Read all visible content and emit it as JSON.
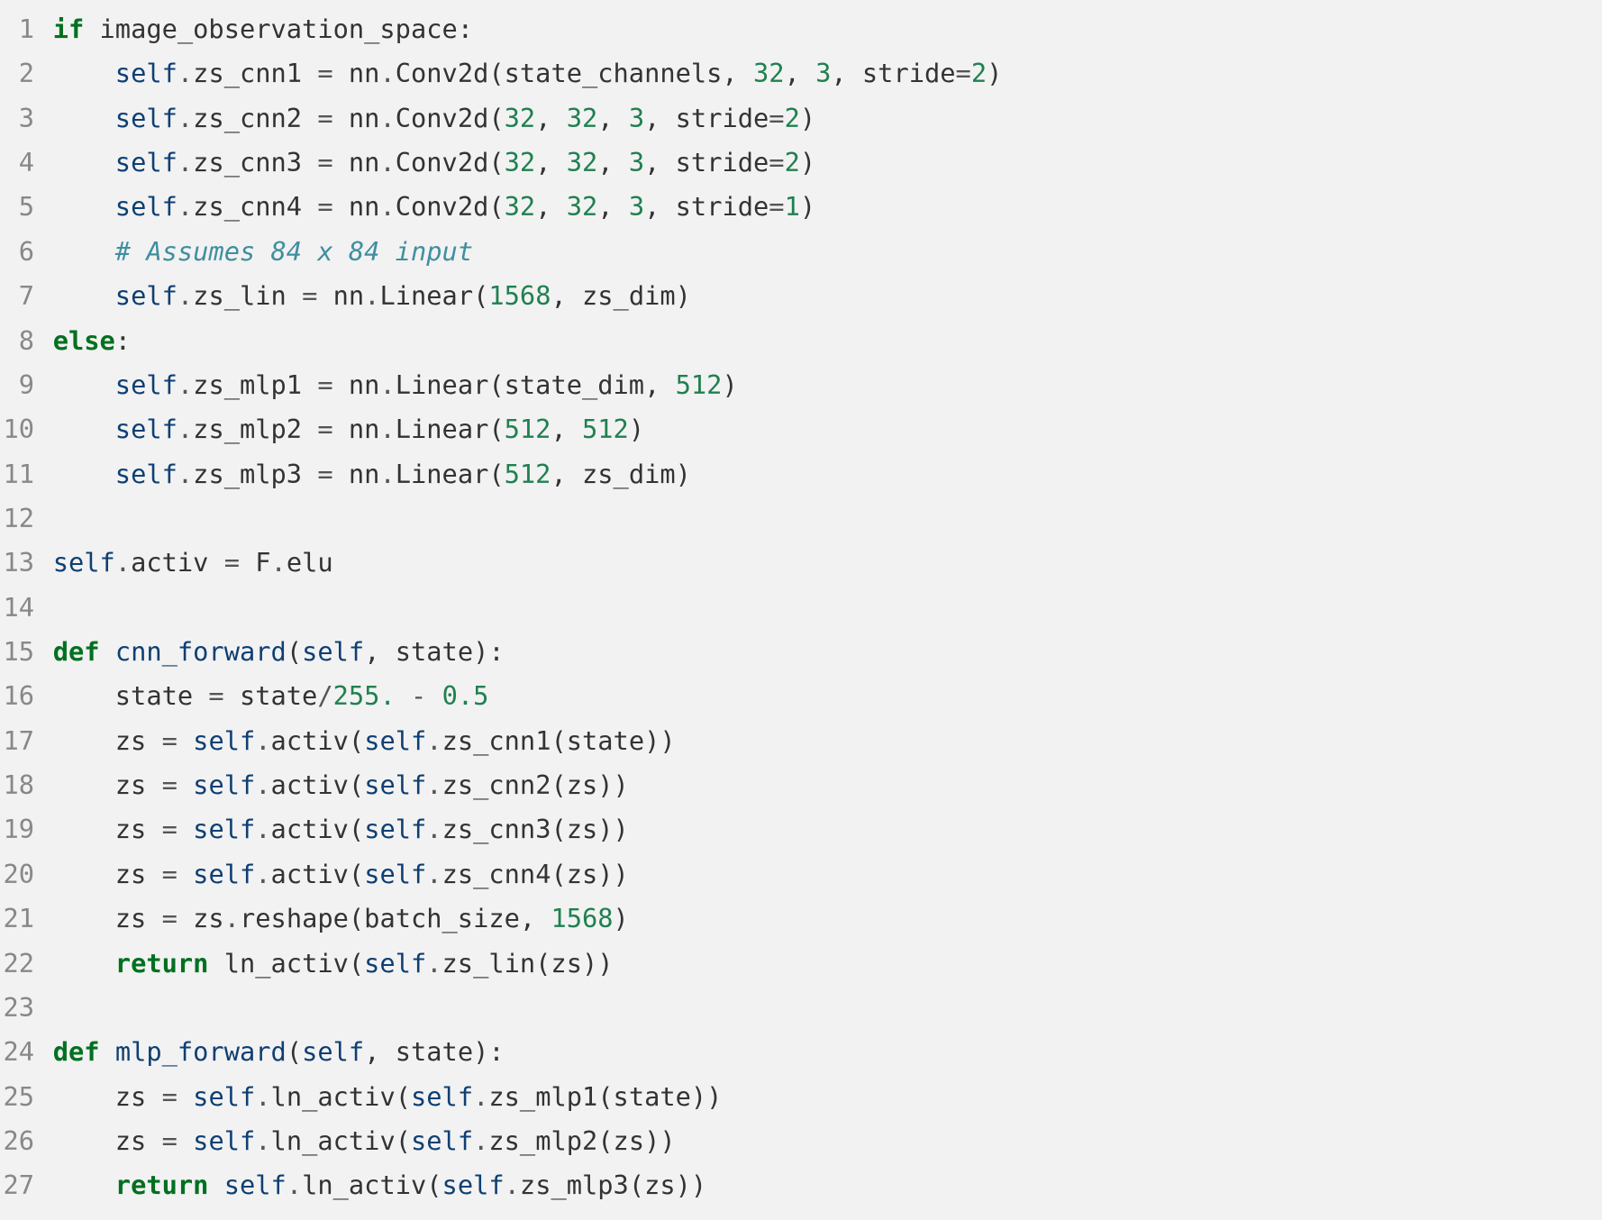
{
  "lines": [
    {
      "n": "1",
      "tokens": [
        {
          "cls": "kw",
          "t": "if"
        },
        {
          "cls": "plain",
          "t": " image_observation_space:"
        }
      ]
    },
    {
      "n": "2",
      "tokens": [
        {
          "cls": "plain",
          "t": "    "
        },
        {
          "cls": "slf",
          "t": "self"
        },
        {
          "cls": "op",
          "t": "."
        },
        {
          "cls": "plain",
          "t": "zs_cnn1 "
        },
        {
          "cls": "op",
          "t": "="
        },
        {
          "cls": "plain",
          "t": " nn"
        },
        {
          "cls": "op",
          "t": "."
        },
        {
          "cls": "plain",
          "t": "Conv2d(state_channels, "
        },
        {
          "cls": "num",
          "t": "32"
        },
        {
          "cls": "plain",
          "t": ", "
        },
        {
          "cls": "num",
          "t": "3"
        },
        {
          "cls": "plain",
          "t": ", stride"
        },
        {
          "cls": "op",
          "t": "="
        },
        {
          "cls": "num",
          "t": "2"
        },
        {
          "cls": "plain",
          "t": ")"
        }
      ]
    },
    {
      "n": "3",
      "tokens": [
        {
          "cls": "plain",
          "t": "    "
        },
        {
          "cls": "slf",
          "t": "self"
        },
        {
          "cls": "op",
          "t": "."
        },
        {
          "cls": "plain",
          "t": "zs_cnn2 "
        },
        {
          "cls": "op",
          "t": "="
        },
        {
          "cls": "plain",
          "t": " nn"
        },
        {
          "cls": "op",
          "t": "."
        },
        {
          "cls": "plain",
          "t": "Conv2d("
        },
        {
          "cls": "num",
          "t": "32"
        },
        {
          "cls": "plain",
          "t": ", "
        },
        {
          "cls": "num",
          "t": "32"
        },
        {
          "cls": "plain",
          "t": ", "
        },
        {
          "cls": "num",
          "t": "3"
        },
        {
          "cls": "plain",
          "t": ", stride"
        },
        {
          "cls": "op",
          "t": "="
        },
        {
          "cls": "num",
          "t": "2"
        },
        {
          "cls": "plain",
          "t": ")"
        }
      ]
    },
    {
      "n": "4",
      "tokens": [
        {
          "cls": "plain",
          "t": "    "
        },
        {
          "cls": "slf",
          "t": "self"
        },
        {
          "cls": "op",
          "t": "."
        },
        {
          "cls": "plain",
          "t": "zs_cnn3 "
        },
        {
          "cls": "op",
          "t": "="
        },
        {
          "cls": "plain",
          "t": " nn"
        },
        {
          "cls": "op",
          "t": "."
        },
        {
          "cls": "plain",
          "t": "Conv2d("
        },
        {
          "cls": "num",
          "t": "32"
        },
        {
          "cls": "plain",
          "t": ", "
        },
        {
          "cls": "num",
          "t": "32"
        },
        {
          "cls": "plain",
          "t": ", "
        },
        {
          "cls": "num",
          "t": "3"
        },
        {
          "cls": "plain",
          "t": ", stride"
        },
        {
          "cls": "op",
          "t": "="
        },
        {
          "cls": "num",
          "t": "2"
        },
        {
          "cls": "plain",
          "t": ")"
        }
      ]
    },
    {
      "n": "5",
      "tokens": [
        {
          "cls": "plain",
          "t": "    "
        },
        {
          "cls": "slf",
          "t": "self"
        },
        {
          "cls": "op",
          "t": "."
        },
        {
          "cls": "plain",
          "t": "zs_cnn4 "
        },
        {
          "cls": "op",
          "t": "="
        },
        {
          "cls": "plain",
          "t": " nn"
        },
        {
          "cls": "op",
          "t": "."
        },
        {
          "cls": "plain",
          "t": "Conv2d("
        },
        {
          "cls": "num",
          "t": "32"
        },
        {
          "cls": "plain",
          "t": ", "
        },
        {
          "cls": "num",
          "t": "32"
        },
        {
          "cls": "plain",
          "t": ", "
        },
        {
          "cls": "num",
          "t": "3"
        },
        {
          "cls": "plain",
          "t": ", stride"
        },
        {
          "cls": "op",
          "t": "="
        },
        {
          "cls": "num",
          "t": "1"
        },
        {
          "cls": "plain",
          "t": ")"
        }
      ]
    },
    {
      "n": "6",
      "tokens": [
        {
          "cls": "plain",
          "t": "    "
        },
        {
          "cls": "cmt",
          "t": "# Assumes 84 x 84 input"
        }
      ]
    },
    {
      "n": "7",
      "tokens": [
        {
          "cls": "plain",
          "t": "    "
        },
        {
          "cls": "slf",
          "t": "self"
        },
        {
          "cls": "op",
          "t": "."
        },
        {
          "cls": "plain",
          "t": "zs_lin "
        },
        {
          "cls": "op",
          "t": "="
        },
        {
          "cls": "plain",
          "t": " nn"
        },
        {
          "cls": "op",
          "t": "."
        },
        {
          "cls": "plain",
          "t": "Linear("
        },
        {
          "cls": "num",
          "t": "1568"
        },
        {
          "cls": "plain",
          "t": ", zs_dim)"
        }
      ]
    },
    {
      "n": "8",
      "tokens": [
        {
          "cls": "kw",
          "t": "else"
        },
        {
          "cls": "plain",
          "t": ":"
        }
      ]
    },
    {
      "n": "9",
      "tokens": [
        {
          "cls": "plain",
          "t": "    "
        },
        {
          "cls": "slf",
          "t": "self"
        },
        {
          "cls": "op",
          "t": "."
        },
        {
          "cls": "plain",
          "t": "zs_mlp1 "
        },
        {
          "cls": "op",
          "t": "="
        },
        {
          "cls": "plain",
          "t": " nn"
        },
        {
          "cls": "op",
          "t": "."
        },
        {
          "cls": "plain",
          "t": "Linear(state_dim, "
        },
        {
          "cls": "num",
          "t": "512"
        },
        {
          "cls": "plain",
          "t": ")"
        }
      ]
    },
    {
      "n": "10",
      "tokens": [
        {
          "cls": "plain",
          "t": "    "
        },
        {
          "cls": "slf",
          "t": "self"
        },
        {
          "cls": "op",
          "t": "."
        },
        {
          "cls": "plain",
          "t": "zs_mlp2 "
        },
        {
          "cls": "op",
          "t": "="
        },
        {
          "cls": "plain",
          "t": " nn"
        },
        {
          "cls": "op",
          "t": "."
        },
        {
          "cls": "plain",
          "t": "Linear("
        },
        {
          "cls": "num",
          "t": "512"
        },
        {
          "cls": "plain",
          "t": ", "
        },
        {
          "cls": "num",
          "t": "512"
        },
        {
          "cls": "plain",
          "t": ")"
        }
      ]
    },
    {
      "n": "11",
      "tokens": [
        {
          "cls": "plain",
          "t": "    "
        },
        {
          "cls": "slf",
          "t": "self"
        },
        {
          "cls": "op",
          "t": "."
        },
        {
          "cls": "plain",
          "t": "zs_mlp3 "
        },
        {
          "cls": "op",
          "t": "="
        },
        {
          "cls": "plain",
          "t": " nn"
        },
        {
          "cls": "op",
          "t": "."
        },
        {
          "cls": "plain",
          "t": "Linear("
        },
        {
          "cls": "num",
          "t": "512"
        },
        {
          "cls": "plain",
          "t": ", zs_dim)"
        }
      ]
    },
    {
      "n": "12",
      "tokens": []
    },
    {
      "n": "13",
      "tokens": [
        {
          "cls": "slf",
          "t": "self"
        },
        {
          "cls": "op",
          "t": "."
        },
        {
          "cls": "plain",
          "t": "activ "
        },
        {
          "cls": "op",
          "t": "="
        },
        {
          "cls": "plain",
          "t": " F"
        },
        {
          "cls": "op",
          "t": "."
        },
        {
          "cls": "plain",
          "t": "elu"
        }
      ]
    },
    {
      "n": "14",
      "tokens": []
    },
    {
      "n": "15",
      "tokens": [
        {
          "cls": "kw",
          "t": "def"
        },
        {
          "cls": "plain",
          "t": " "
        },
        {
          "cls": "nf",
          "t": "cnn_forward"
        },
        {
          "cls": "plain",
          "t": "("
        },
        {
          "cls": "slf",
          "t": "self"
        },
        {
          "cls": "plain",
          "t": ", state):"
        }
      ]
    },
    {
      "n": "16",
      "tokens": [
        {
          "cls": "plain",
          "t": "    state "
        },
        {
          "cls": "op",
          "t": "="
        },
        {
          "cls": "plain",
          "t": " state"
        },
        {
          "cls": "op",
          "t": "/"
        },
        {
          "cls": "num",
          "t": "255."
        },
        {
          "cls": "plain",
          "t": " "
        },
        {
          "cls": "op",
          "t": "-"
        },
        {
          "cls": "plain",
          "t": " "
        },
        {
          "cls": "num",
          "t": "0.5"
        }
      ]
    },
    {
      "n": "17",
      "tokens": [
        {
          "cls": "plain",
          "t": "    zs "
        },
        {
          "cls": "op",
          "t": "="
        },
        {
          "cls": "plain",
          "t": " "
        },
        {
          "cls": "slf",
          "t": "self"
        },
        {
          "cls": "op",
          "t": "."
        },
        {
          "cls": "plain",
          "t": "activ("
        },
        {
          "cls": "slf",
          "t": "self"
        },
        {
          "cls": "op",
          "t": "."
        },
        {
          "cls": "plain",
          "t": "zs_cnn1(state))"
        }
      ]
    },
    {
      "n": "18",
      "tokens": [
        {
          "cls": "plain",
          "t": "    zs "
        },
        {
          "cls": "op",
          "t": "="
        },
        {
          "cls": "plain",
          "t": " "
        },
        {
          "cls": "slf",
          "t": "self"
        },
        {
          "cls": "op",
          "t": "."
        },
        {
          "cls": "plain",
          "t": "activ("
        },
        {
          "cls": "slf",
          "t": "self"
        },
        {
          "cls": "op",
          "t": "."
        },
        {
          "cls": "plain",
          "t": "zs_cnn2(zs))"
        }
      ]
    },
    {
      "n": "19",
      "tokens": [
        {
          "cls": "plain",
          "t": "    zs "
        },
        {
          "cls": "op",
          "t": "="
        },
        {
          "cls": "plain",
          "t": " "
        },
        {
          "cls": "slf",
          "t": "self"
        },
        {
          "cls": "op",
          "t": "."
        },
        {
          "cls": "plain",
          "t": "activ("
        },
        {
          "cls": "slf",
          "t": "self"
        },
        {
          "cls": "op",
          "t": "."
        },
        {
          "cls": "plain",
          "t": "zs_cnn3(zs))"
        }
      ]
    },
    {
      "n": "20",
      "tokens": [
        {
          "cls": "plain",
          "t": "    zs "
        },
        {
          "cls": "op",
          "t": "="
        },
        {
          "cls": "plain",
          "t": " "
        },
        {
          "cls": "slf",
          "t": "self"
        },
        {
          "cls": "op",
          "t": "."
        },
        {
          "cls": "plain",
          "t": "activ("
        },
        {
          "cls": "slf",
          "t": "self"
        },
        {
          "cls": "op",
          "t": "."
        },
        {
          "cls": "plain",
          "t": "zs_cnn4(zs))"
        }
      ]
    },
    {
      "n": "21",
      "tokens": [
        {
          "cls": "plain",
          "t": "    zs "
        },
        {
          "cls": "op",
          "t": "="
        },
        {
          "cls": "plain",
          "t": " zs"
        },
        {
          "cls": "op",
          "t": "."
        },
        {
          "cls": "plain",
          "t": "reshape(batch_size, "
        },
        {
          "cls": "num",
          "t": "1568"
        },
        {
          "cls": "plain",
          "t": ")"
        }
      ]
    },
    {
      "n": "22",
      "tokens": [
        {
          "cls": "plain",
          "t": "    "
        },
        {
          "cls": "kw",
          "t": "return"
        },
        {
          "cls": "plain",
          "t": " ln_activ("
        },
        {
          "cls": "slf",
          "t": "self"
        },
        {
          "cls": "op",
          "t": "."
        },
        {
          "cls": "plain",
          "t": "zs_lin(zs))"
        }
      ]
    },
    {
      "n": "23",
      "tokens": []
    },
    {
      "n": "24",
      "tokens": [
        {
          "cls": "kw",
          "t": "def"
        },
        {
          "cls": "plain",
          "t": " "
        },
        {
          "cls": "nf",
          "t": "mlp_forward"
        },
        {
          "cls": "plain",
          "t": "("
        },
        {
          "cls": "slf",
          "t": "self"
        },
        {
          "cls": "plain",
          "t": ", state):"
        }
      ]
    },
    {
      "n": "25",
      "tokens": [
        {
          "cls": "plain",
          "t": "    zs "
        },
        {
          "cls": "op",
          "t": "="
        },
        {
          "cls": "plain",
          "t": " "
        },
        {
          "cls": "slf",
          "t": "self"
        },
        {
          "cls": "op",
          "t": "."
        },
        {
          "cls": "plain",
          "t": "ln_activ("
        },
        {
          "cls": "slf",
          "t": "self"
        },
        {
          "cls": "op",
          "t": "."
        },
        {
          "cls": "plain",
          "t": "zs_mlp1(state))"
        }
      ]
    },
    {
      "n": "26",
      "tokens": [
        {
          "cls": "plain",
          "t": "    zs "
        },
        {
          "cls": "op",
          "t": "="
        },
        {
          "cls": "plain",
          "t": " "
        },
        {
          "cls": "slf",
          "t": "self"
        },
        {
          "cls": "op",
          "t": "."
        },
        {
          "cls": "plain",
          "t": "ln_activ("
        },
        {
          "cls": "slf",
          "t": "self"
        },
        {
          "cls": "op",
          "t": "."
        },
        {
          "cls": "plain",
          "t": "zs_mlp2(zs))"
        }
      ]
    },
    {
      "n": "27",
      "tokens": [
        {
          "cls": "plain",
          "t": "    "
        },
        {
          "cls": "kw",
          "t": "return"
        },
        {
          "cls": "plain",
          "t": " "
        },
        {
          "cls": "slf",
          "t": "self"
        },
        {
          "cls": "op",
          "t": "."
        },
        {
          "cls": "plain",
          "t": "ln_activ("
        },
        {
          "cls": "slf",
          "t": "self"
        },
        {
          "cls": "op",
          "t": "."
        },
        {
          "cls": "plain",
          "t": "zs_mlp3(zs))"
        }
      ]
    }
  ]
}
